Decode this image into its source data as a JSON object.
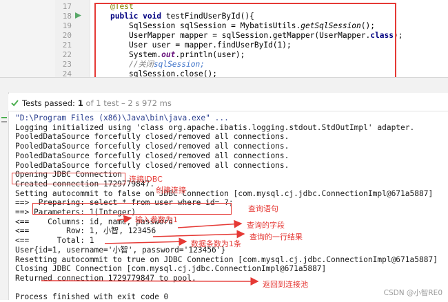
{
  "editor": {
    "line_numbers": [
      "17",
      "18",
      "19",
      "20",
      "21",
      "22",
      "23",
      "24"
    ],
    "lines": {
      "l0": "@Test",
      "l1_kw": "public void",
      "l1_rest": " testFindUserById(){",
      "l2_a": "SqlSession sqlSession = MybatisUtils.",
      "l2_b": "getSqlSession",
      "l2_c": "();",
      "l3_a": "UserMapper mapper = sqlSession.getMapper(UserMapper.",
      "l3_kw": "class",
      "l3_c": ");",
      "l4": "User user = mapper.findUserById(1);",
      "l5_a": "System.",
      "l5_b": "out",
      "l5_c": ".println(user);",
      "l6_a": "//关闭",
      "l6_b": "sqlSession;",
      "l7": "sqlSession.close();"
    }
  },
  "tests": {
    "status": "Tests passed:",
    "count": " 1",
    "detail": " of 1 test – 2 s 972 ms"
  },
  "console": {
    "lines": [
      "\"D:\\Program Files (x86)\\Java\\bin\\java.exe\" ...",
      "Logging initialized using 'class org.apache.ibatis.logging.stdout.StdOutImpl' adapter.",
      "PooledDataSource forcefully closed/removed all connections.",
      "PooledDataSource forcefully closed/removed all connections.",
      "PooledDataSource forcefully closed/removed all connections.",
      "PooledDataSource forcefully closed/removed all connections.",
      "Opening JDBC Connection",
      "Created connection 1729779847.",
      "Setting autocommit to false on JDBC Connection [com.mysql.cj.jdbc.ConnectionImpl@671a5887]",
      "==>  Preparing: select * from user where id= ?;",
      "==> Parameters: 1(Integer)",
      "<==    Columns: id, name, password",
      "<==        Row: 1, 小智, 123456",
      "<==      Total: 1",
      "User{id=1, username='小智', password='123456'}",
      "Resetting autocommit to true on JDBC Connection [com.mysql.cj.jdbc.ConnectionImpl@671a5887]",
      "Closing JDBC Connection [com.mysql.cj.jdbc.ConnectionImpl@671a5887]",
      "Returned connection 1729779847 to pool.",
      "",
      "Process finished with exit code 0"
    ]
  },
  "annotations": {
    "connect_jdbc": "连接JDBC",
    "create_connection": "创建连接",
    "query_statement": "查询语句",
    "input_param": "输入参数为1",
    "query_fields": "查询的字段",
    "query_row": "查询的一行结果",
    "row_count": "数据条数为1条",
    "return_pool": "返回到连接池"
  },
  "watermark": "CSDN @小智RE0",
  "colors": {
    "accent_red": "#e53935",
    "pass_green": "#4caf50",
    "keyword": "#000080"
  }
}
